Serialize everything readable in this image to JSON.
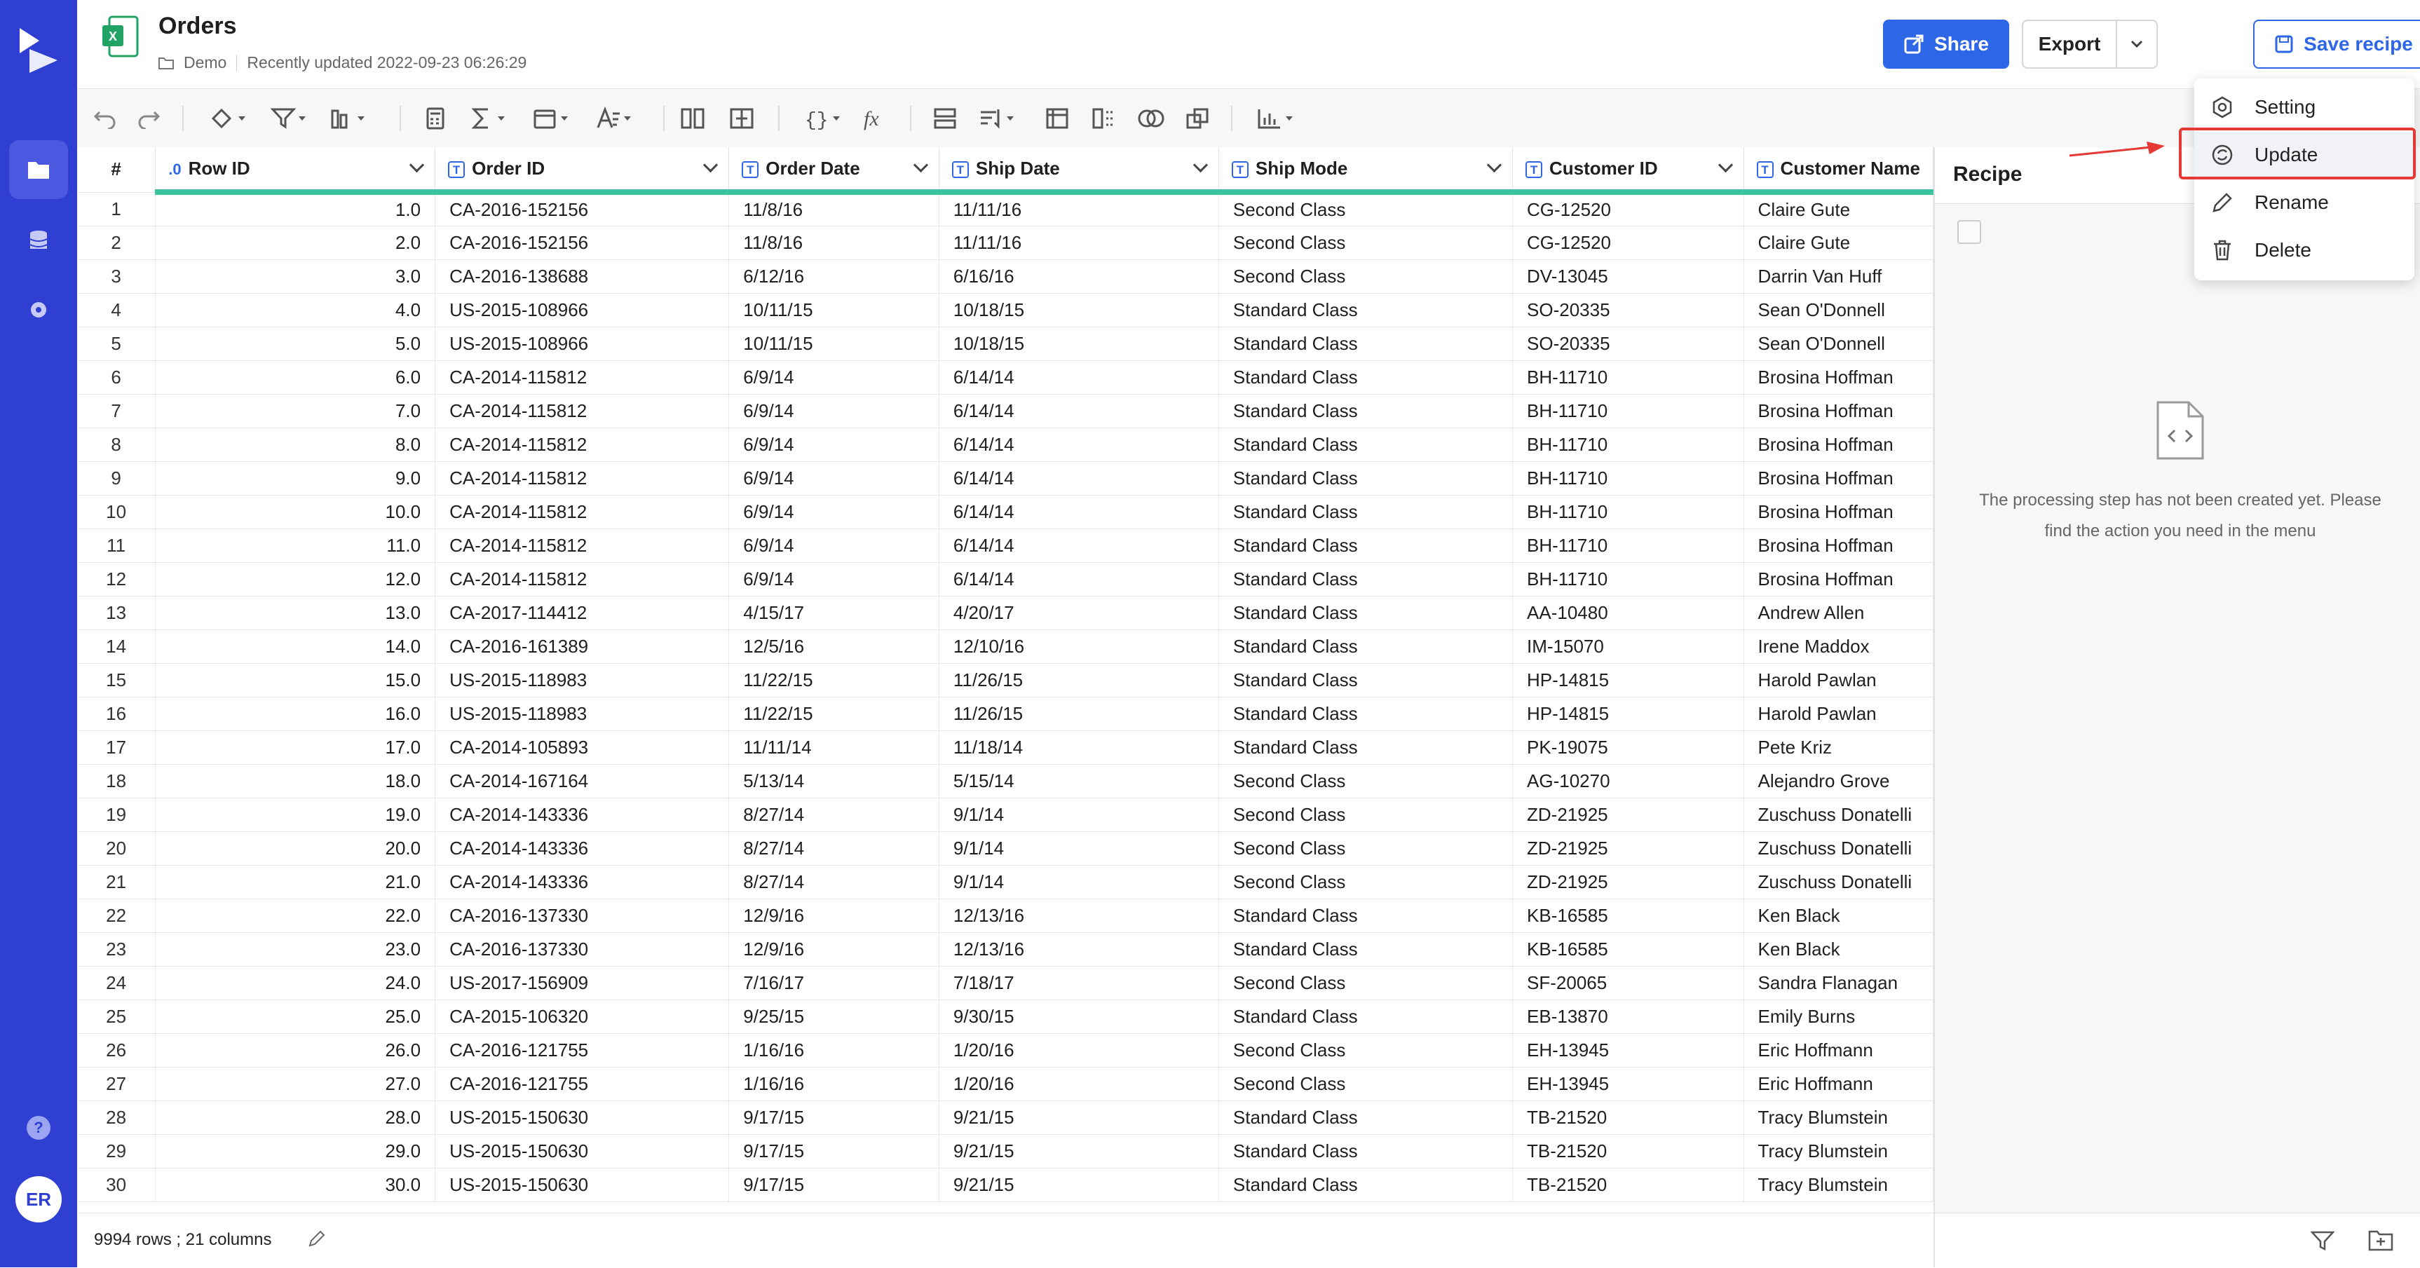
{
  "app": {
    "title": "Orders",
    "folder": "Demo",
    "updated": "Recently updated 2022-09-23 06:26:29",
    "avatar": "ER",
    "help": "?"
  },
  "header": {
    "share": "Share",
    "export": "Export",
    "save_recipe": "Save recipe",
    "more": "···"
  },
  "columns": [
    "#",
    "Row ID",
    "Order ID",
    "Order Date",
    "Ship Date",
    "Ship Mode",
    "Customer ID",
    "Customer Name"
  ],
  "rows": [
    [
      "1",
      "1.0",
      "CA-2016-152156",
      "11/8/16",
      "11/11/16",
      "Second Class",
      "CG-12520",
      "Claire Gute"
    ],
    [
      "2",
      "2.0",
      "CA-2016-152156",
      "11/8/16",
      "11/11/16",
      "Second Class",
      "CG-12520",
      "Claire Gute"
    ],
    [
      "3",
      "3.0",
      "CA-2016-138688",
      "6/12/16",
      "6/16/16",
      "Second Class",
      "DV-13045",
      "Darrin Van Huff"
    ],
    [
      "4",
      "4.0",
      "US-2015-108966",
      "10/11/15",
      "10/18/15",
      "Standard Class",
      "SO-20335",
      "Sean O'Donnell"
    ],
    [
      "5",
      "5.0",
      "US-2015-108966",
      "10/11/15",
      "10/18/15",
      "Standard Class",
      "SO-20335",
      "Sean O'Donnell"
    ],
    [
      "6",
      "6.0",
      "CA-2014-115812",
      "6/9/14",
      "6/14/14",
      "Standard Class",
      "BH-11710",
      "Brosina Hoffman"
    ],
    [
      "7",
      "7.0",
      "CA-2014-115812",
      "6/9/14",
      "6/14/14",
      "Standard Class",
      "BH-11710",
      "Brosina Hoffman"
    ],
    [
      "8",
      "8.0",
      "CA-2014-115812",
      "6/9/14",
      "6/14/14",
      "Standard Class",
      "BH-11710",
      "Brosina Hoffman"
    ],
    [
      "9",
      "9.0",
      "CA-2014-115812",
      "6/9/14",
      "6/14/14",
      "Standard Class",
      "BH-11710",
      "Brosina Hoffman"
    ],
    [
      "10",
      "10.0",
      "CA-2014-115812",
      "6/9/14",
      "6/14/14",
      "Standard Class",
      "BH-11710",
      "Brosina Hoffman"
    ],
    [
      "11",
      "11.0",
      "CA-2014-115812",
      "6/9/14",
      "6/14/14",
      "Standard Class",
      "BH-11710",
      "Brosina Hoffman"
    ],
    [
      "12",
      "12.0",
      "CA-2014-115812",
      "6/9/14",
      "6/14/14",
      "Standard Class",
      "BH-11710",
      "Brosina Hoffman"
    ],
    [
      "13",
      "13.0",
      "CA-2017-114412",
      "4/15/17",
      "4/20/17",
      "Standard Class",
      "AA-10480",
      "Andrew Allen"
    ],
    [
      "14",
      "14.0",
      "CA-2016-161389",
      "12/5/16",
      "12/10/16",
      "Standard Class",
      "IM-15070",
      "Irene Maddox"
    ],
    [
      "15",
      "15.0",
      "US-2015-118983",
      "11/22/15",
      "11/26/15",
      "Standard Class",
      "HP-14815",
      "Harold Pawlan"
    ],
    [
      "16",
      "16.0",
      "US-2015-118983",
      "11/22/15",
      "11/26/15",
      "Standard Class",
      "HP-14815",
      "Harold Pawlan"
    ],
    [
      "17",
      "17.0",
      "CA-2014-105893",
      "11/11/14",
      "11/18/14",
      "Standard Class",
      "PK-19075",
      "Pete Kriz"
    ],
    [
      "18",
      "18.0",
      "CA-2014-167164",
      "5/13/14",
      "5/15/14",
      "Second Class",
      "AG-10270",
      "Alejandro Grove"
    ],
    [
      "19",
      "19.0",
      "CA-2014-143336",
      "8/27/14",
      "9/1/14",
      "Second Class",
      "ZD-21925",
      "Zuschuss Donatelli"
    ],
    [
      "20",
      "20.0",
      "CA-2014-143336",
      "8/27/14",
      "9/1/14",
      "Second Class",
      "ZD-21925",
      "Zuschuss Donatelli"
    ],
    [
      "21",
      "21.0",
      "CA-2014-143336",
      "8/27/14",
      "9/1/14",
      "Second Class",
      "ZD-21925",
      "Zuschuss Donatelli"
    ],
    [
      "22",
      "22.0",
      "CA-2016-137330",
      "12/9/16",
      "12/13/16",
      "Standard Class",
      "KB-16585",
      "Ken Black"
    ],
    [
      "23",
      "23.0",
      "CA-2016-137330",
      "12/9/16",
      "12/13/16",
      "Standard Class",
      "KB-16585",
      "Ken Black"
    ],
    [
      "24",
      "24.0",
      "US-2017-156909",
      "7/16/17",
      "7/18/17",
      "Second Class",
      "SF-20065",
      "Sandra Flanagan"
    ],
    [
      "25",
      "25.0",
      "CA-2015-106320",
      "9/25/15",
      "9/30/15",
      "Standard Class",
      "EB-13870",
      "Emily Burns"
    ],
    [
      "26",
      "26.0",
      "CA-2016-121755",
      "1/16/16",
      "1/20/16",
      "Second Class",
      "EH-13945",
      "Eric Hoffmann"
    ],
    [
      "27",
      "27.0",
      "CA-2016-121755",
      "1/16/16",
      "1/20/16",
      "Second Class",
      "EH-13945",
      "Eric Hoffmann"
    ],
    [
      "28",
      "28.0",
      "US-2015-150630",
      "9/17/15",
      "9/21/15",
      "Standard Class",
      "TB-21520",
      "Tracy Blumstein"
    ],
    [
      "29",
      "29.0",
      "US-2015-150630",
      "9/17/15",
      "9/21/15",
      "Standard Class",
      "TB-21520",
      "Tracy Blumstein"
    ],
    [
      "30",
      "30.0",
      "US-2015-150630",
      "9/17/15",
      "9/21/15",
      "Standard Class",
      "TB-21520",
      "Tracy Blumstein"
    ]
  ],
  "footer": {
    "summary": "9994 rows ; 21 columns"
  },
  "recipe": {
    "title": "Recipe",
    "empty": "The processing step has not been created yet. Please find the action you need in the menu"
  },
  "menu": {
    "setting": "Setting",
    "update": "Update",
    "rename": "Rename",
    "delete": "Delete"
  },
  "colors": {
    "sidebar": "#2e3fd1",
    "primary": "#2e66e8",
    "accent_line": "#3ac5a0",
    "highlight": "#e53935"
  }
}
